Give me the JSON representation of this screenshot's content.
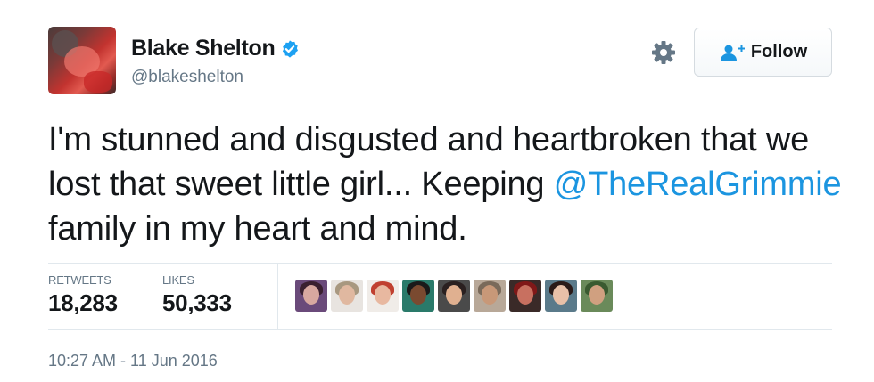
{
  "author": {
    "display_name": "Blake Shelton",
    "handle": "@blakeshelton",
    "verified": true,
    "verified_icon": "verified-badge-icon"
  },
  "actions": {
    "settings_icon": "gear-icon",
    "follow_label": "Follow",
    "follow_icon": "add-user-icon"
  },
  "tweet": {
    "text_part1": "I'm stunned and disgusted and heartbroken that we lost that sweet little girl... Keeping ",
    "mention": "@TheRealGrimmie",
    "text_part2": " family in my heart and mind."
  },
  "stats": {
    "retweets_label": "RETWEETS",
    "retweets_value": "18,283",
    "likes_label": "LIKES",
    "likes_value": "50,333"
  },
  "likers": [
    {
      "name": "liker-avatar-1",
      "bg": "#6a4a7a",
      "face": "#d8a8a0",
      "hair": "#3a2030"
    },
    {
      "name": "liker-avatar-2",
      "bg": "#e8e4e0",
      "face": "#e0b8a0",
      "hair": "#a89880"
    },
    {
      "name": "liker-avatar-3",
      "bg": "#f0ece8",
      "face": "#e8b8a0",
      "hair": "#c04030"
    },
    {
      "name": "liker-avatar-4",
      "bg": "#2a7a6a",
      "face": "#7a4a30",
      "hair": "#1a1a1a"
    },
    {
      "name": "liker-avatar-5",
      "bg": "#4a4a4a",
      "face": "#e0b090",
      "hair": "#2a2020"
    },
    {
      "name": "liker-avatar-6",
      "bg": "#b8a898",
      "face": "#c89878",
      "hair": "#7a6a5a"
    },
    {
      "name": "liker-avatar-7",
      "bg": "#3a2a28",
      "face": "#c87060",
      "hair": "#801818"
    },
    {
      "name": "liker-avatar-8",
      "bg": "#5a7a8a",
      "face": "#e8c0a8",
      "hair": "#2a1a18"
    },
    {
      "name": "liker-avatar-9",
      "bg": "#6a8a5a",
      "face": "#d0a080",
      "hair": "#3a5a30"
    }
  ],
  "timestamp": "10:27 AM - 11 Jun 2016",
  "colors": {
    "link": "#1b95e0",
    "verified": "#1da1f2",
    "secondary_text": "#657786"
  }
}
